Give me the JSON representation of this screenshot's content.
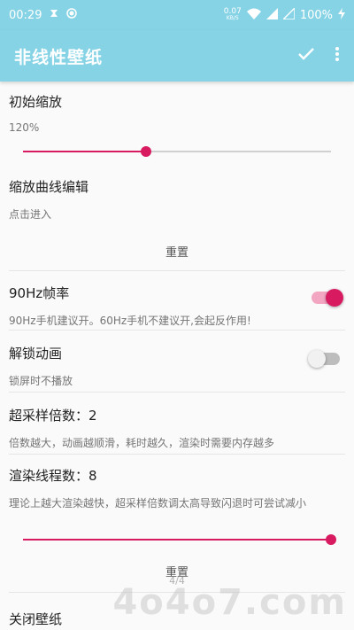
{
  "status_bar": {
    "time": "00:29",
    "net_speed": "0.07",
    "net_unit": "KB/S",
    "battery": "100%"
  },
  "app_bar": {
    "title": "非线性壁纸",
    "confirm_icon": "check-icon",
    "menu_icon": "more-vert-icon"
  },
  "settings": {
    "initial_zoom": {
      "label": "初始缩放",
      "value_text": "120%",
      "level": 0.4
    },
    "curve_edit": {
      "label": "缩放曲线编辑",
      "summary": "点击进入"
    },
    "reset_1": "重置",
    "fps90": {
      "label": "90Hz帧率",
      "summary": "90Hz手机建议开。60Hz手机不建议开,会起反作用!",
      "enabled": true
    },
    "unlock_anim": {
      "label": "解锁动画",
      "summary": "锁屏时不播放",
      "enabled": false
    },
    "supersample": {
      "label": "超采样倍数：2",
      "summary": "倍数越大，动画越顺滑，耗时越久，渲染时需要内存越多"
    },
    "render_threads": {
      "label": "渲染线程数：8",
      "summary": "理论上越大渲染越快，超采样倍数调太高导致闪退时可尝试减小",
      "level": 1.0
    },
    "reset_2": "重置",
    "pager": "4/4",
    "close_wallpaper": {
      "label": "关闭壁纸"
    }
  },
  "watermark": "4o4o7.com",
  "colors": {
    "accent": "#d81b60",
    "primary": "#86d3e6"
  }
}
